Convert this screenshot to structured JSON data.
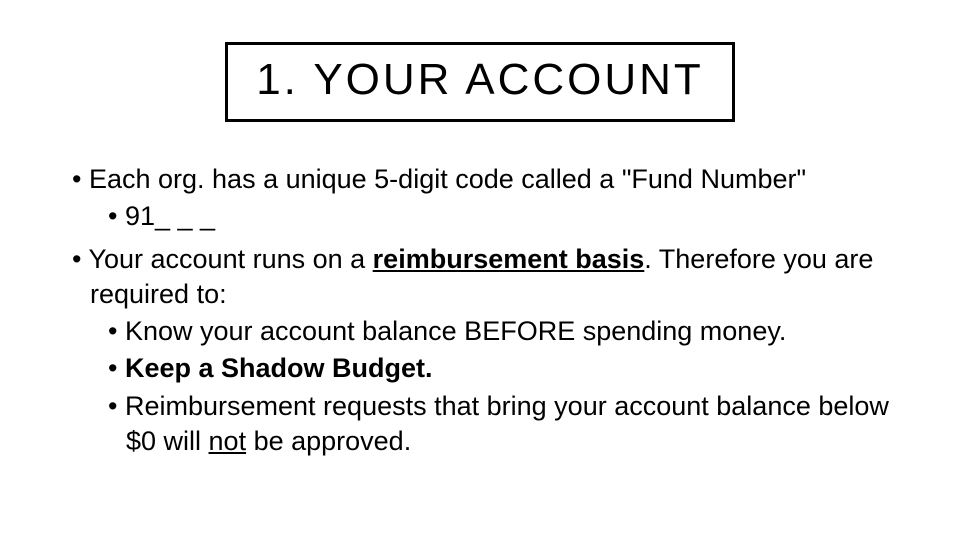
{
  "title": "1. YOUR ACCOUNT",
  "p1_a": "Each org. has a unique 5-digit code called a \"Fund Number\"",
  "p1_sub": "91_ _ _",
  "p2_a": "Your account runs on a ",
  "p2_b": "reimbursement basis",
  "p2_c": ".  Therefore you are required to:",
  "p2_s1": "Know your account balance BEFORE spending money.",
  "p2_s2": "Keep a Shadow Budget.",
  "p2_s3a": "Reimbursement requests that bring your account balance below $0 will ",
  "p2_s3b": "not",
  "p2_s3c": " be approved."
}
